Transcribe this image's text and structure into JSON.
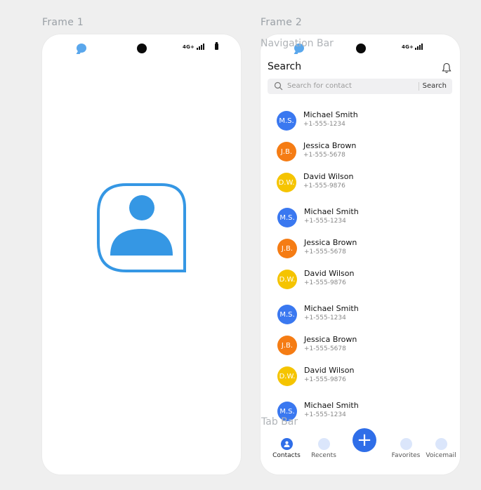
{
  "frames": [
    {
      "label": "Frame 1"
    },
    {
      "label": "Frame 2"
    }
  ],
  "status_bar": {
    "network": "4G+"
  },
  "overlays": {
    "navigation_bar": "Navigation Bar",
    "tab_bar": "Tab Bar"
  },
  "splash": {
    "icon": "contact-book-icon",
    "color": "#3597e4"
  },
  "header": {
    "title": "Search",
    "notification_icon": "bell-icon"
  },
  "search": {
    "placeholder": "Search for contact",
    "button_label": "Search"
  },
  "contacts": [
    {
      "initials": "M.S.",
      "name": "Michael Smith",
      "phone": "+1-555-1234",
      "color": "#3a78f0"
    },
    {
      "initials": "J.B.",
      "name": "Jessica Brown",
      "phone": "+1-555-5678",
      "color": "#f57c14"
    },
    {
      "initials": "D.W.",
      "name": "David Wilson",
      "phone": "+1-555-9876",
      "color": "#f5c400"
    },
    {
      "initials": "M.S.",
      "name": "Michael Smith",
      "phone": "+1-555-1234",
      "color": "#3a78f0"
    },
    {
      "initials": "J.B.",
      "name": "Jessica Brown",
      "phone": "+1-555-5678",
      "color": "#f57c14"
    },
    {
      "initials": "D.W.",
      "name": "David Wilson",
      "phone": "+1-555-9876",
      "color": "#f5c400"
    },
    {
      "initials": "M.S.",
      "name": "Michael Smith",
      "phone": "+1-555-1234",
      "color": "#3a78f0"
    },
    {
      "initials": "J.B.",
      "name": "Jessica Brown",
      "phone": "+1-555-5678",
      "color": "#f57c14"
    },
    {
      "initials": "D.W.",
      "name": "David Wilson",
      "phone": "+1-555-9876",
      "color": "#f5c400"
    },
    {
      "initials": "M.S.",
      "name": "Michael Smith",
      "phone": "+1-555-1234",
      "color": "#3a78f0"
    }
  ],
  "tab_bar": {
    "tabs": [
      {
        "label": "Contacts",
        "icon": "person-icon",
        "active": true
      },
      {
        "label": "Recents",
        "icon": "clock-icon",
        "active": false
      },
      {
        "label": "Favorites",
        "icon": "star-icon",
        "active": false
      },
      {
        "label": "Voicemail",
        "icon": "voicemail-icon",
        "active": false
      }
    ],
    "fab_label": "+",
    "accent": "#2f6ee8"
  }
}
